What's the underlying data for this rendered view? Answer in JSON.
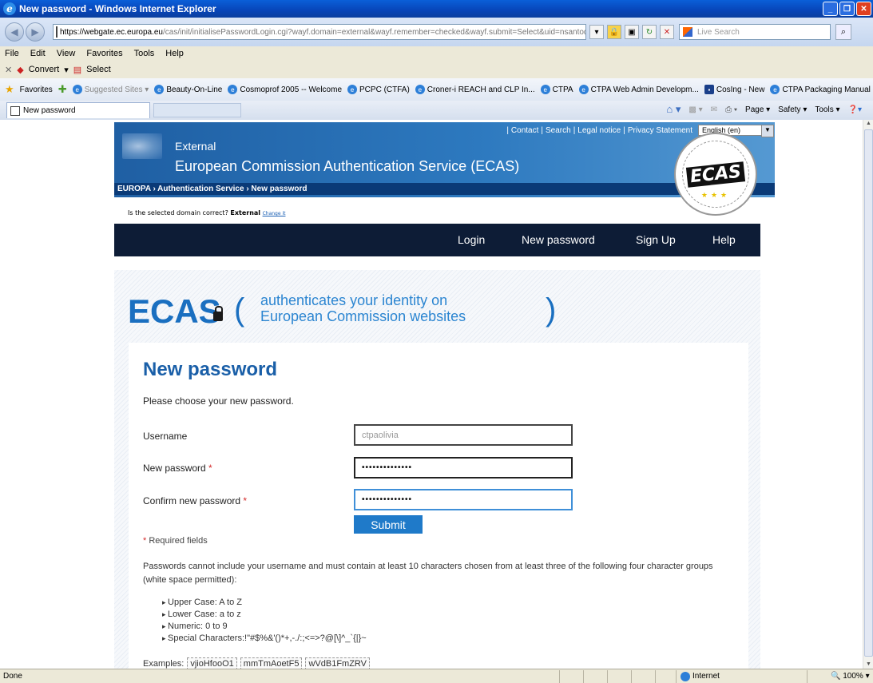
{
  "window": {
    "title": "New password - Windows Internet Explorer"
  },
  "address": {
    "scheme": "https://",
    "host": "webgate.ec.europa.eu",
    "path": "/cas/init/initialisePasswordLogin.cgi?wayf.domain=external&wayf.remember=checked&wayf.submit=Select&uid=nsantodi",
    "search_placeholder": "Live Search"
  },
  "menu": [
    "File",
    "Edit",
    "View",
    "Favorites",
    "Tools",
    "Help"
  ],
  "toolbar": {
    "convert": "Convert",
    "select": "Select"
  },
  "favorites": {
    "label": "Favorites",
    "items": [
      "Suggested Sites ▾",
      "Beauty-On-Line",
      "Cosmoprof 2005 -- Welcome",
      "PCPC (CTFA)",
      "Croner-i REACH and CLP In...",
      "CTPA",
      "CTPA Web Admin Developm...",
      "CosIng - New",
      "CTPA Packaging Manual"
    ]
  },
  "tab": {
    "label": "New password"
  },
  "commandbar": {
    "page": "Page ▾",
    "safety": "Safety ▾",
    "tools": "Tools ▾"
  },
  "status": {
    "text": "Done",
    "zone": "Internet",
    "zoom": "100%"
  },
  "header": {
    "links": [
      "Contact",
      "Search",
      "Legal notice",
      "Privacy Statement"
    ],
    "language": "English (en)",
    "subtitle": "External",
    "title": "European Commission Authentication Service (ECAS)",
    "breadcrumb": "EUROPA › Authentication Service › New password",
    "seal_text": "ECAS"
  },
  "domain": {
    "question": "Is the selected domain correct?",
    "value": "External",
    "change": "Change it"
  },
  "nav": {
    "items": [
      "Login",
      "New password",
      "Sign Up",
      "Help"
    ]
  },
  "banner": {
    "brand": "ECAS",
    "open_paren": "(",
    "close_paren": ")",
    "line1": "authenticates your identity on",
    "line2": "European Commission websites"
  },
  "form": {
    "heading": "New password",
    "intro": "Please choose your new password.",
    "username_label": "Username",
    "username_value": "ctpaolivia",
    "new_label": "New password",
    "new_value": "••••••••••••••",
    "confirm_label": "Confirm new password",
    "confirm_value": "••••••••••••••",
    "required_mark": "*",
    "submit": "Submit",
    "required_note": "Required fields"
  },
  "rules": {
    "text": "Passwords cannot include your username and must contain at least 10 characters chosen from at least three of the following four character groups (white space permitted):",
    "groups": [
      "Upper Case: A to Z",
      "Lower Case: a to z",
      "Numeric: 0 to 9",
      "Special Characters:!\"#$%&'()*+,-./:;<=>?@[\\]^_`{|}~"
    ],
    "examples_label": "Examples:",
    "examples": [
      "vjioHfooO1",
      "mmTmAoetF5",
      "wVdB1FmZRV"
    ]
  }
}
